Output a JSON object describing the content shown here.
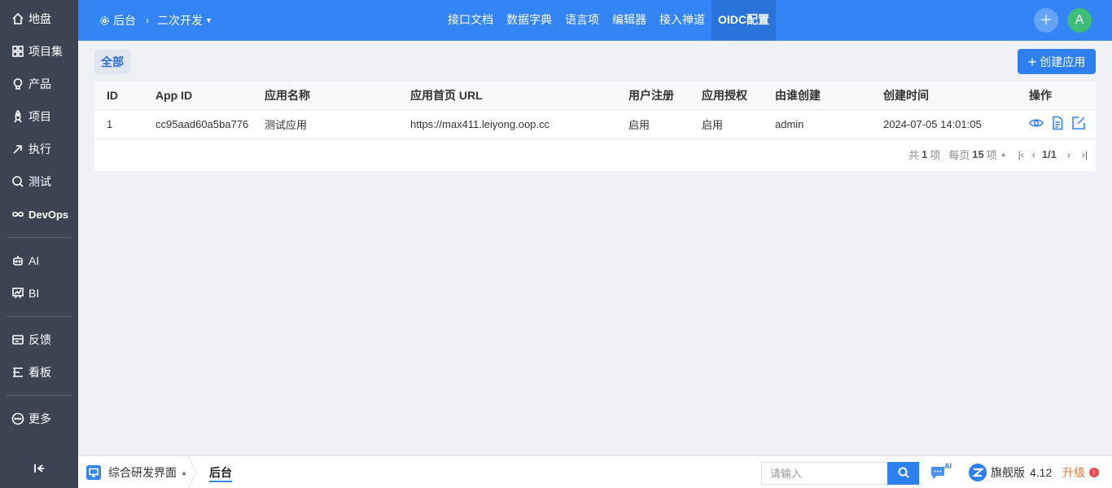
{
  "sidebar": {
    "items": [
      {
        "label": "地盘",
        "icon": "home-icon"
      },
      {
        "label": "项目集",
        "icon": "grid-icon"
      },
      {
        "label": "产品",
        "icon": "bulb-icon"
      },
      {
        "label": "项目",
        "icon": "rocket-icon"
      },
      {
        "label": "执行",
        "icon": "run-icon"
      },
      {
        "label": "测试",
        "icon": "bug-search-icon"
      },
      {
        "label": "DevOps",
        "icon": "infinity-icon"
      },
      {
        "label": "AI",
        "icon": "robot-icon"
      },
      {
        "label": "BI",
        "icon": "chart-board-icon"
      },
      {
        "label": "反馈",
        "icon": "feedback-icon"
      },
      {
        "label": "看板",
        "icon": "kanban-icon"
      },
      {
        "label": "更多",
        "icon": "more-icon"
      }
    ],
    "collapse_icon": "collapse-left-icon"
  },
  "header": {
    "breadcrumb_root": "后台",
    "breadcrumb_current": "二次开发",
    "nav": [
      "接口文档",
      "数据字典",
      "语言项",
      "编辑器",
      "接入禅道",
      "OIDC配置"
    ],
    "active_nav": "OIDC配置",
    "avatar_letter": "A",
    "accent": "#3385f6"
  },
  "toolbar": {
    "filter_all": "全部",
    "create_label": "创建应用"
  },
  "table": {
    "columns": [
      "ID",
      "App ID",
      "应用名称",
      "应用首页 URL",
      "用户注册",
      "应用授权",
      "由谁创建",
      "创建时间",
      "操作"
    ],
    "rows": [
      {
        "id": "1",
        "app_id": "cc95aad60a5ba776",
        "name": "测试应用",
        "url": "https://max411.leiyong.oop.cc",
        "register": "启用",
        "authorize": "启用",
        "creator": "admin",
        "created": "2024-07-05 14:01:05"
      }
    ]
  },
  "pager": {
    "total_prefix": "共",
    "total": "1",
    "total_suffix": "项",
    "per_page_prefix": "每页",
    "per_page": "15",
    "per_page_suffix": "项",
    "page": "1/1"
  },
  "bottombar": {
    "app_label": "综合研发界面",
    "tab": "后台",
    "search_placeholder": "请输入",
    "ai_badge": "AI",
    "edition": "旗舰版",
    "version": "4.12",
    "upgrade": "升级"
  }
}
